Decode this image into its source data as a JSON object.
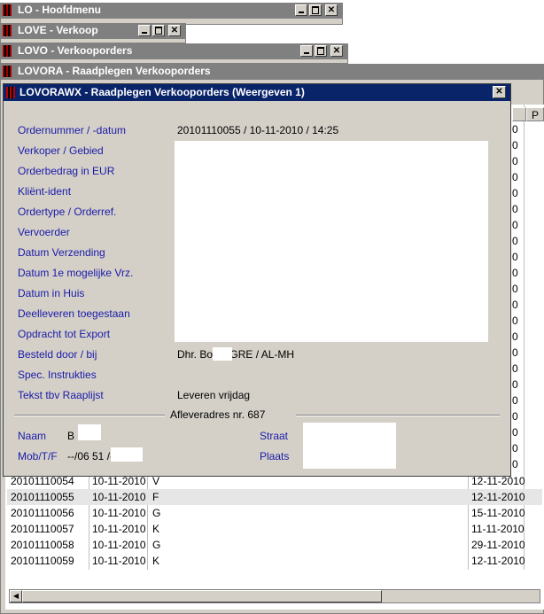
{
  "windows": [
    {
      "title": "LO - Hoofdmenu"
    },
    {
      "title": "LOVE - Verkoop"
    },
    {
      "title": "LOVO - Verkooporders"
    },
    {
      "title": "LOVORA - Raadplegen Verkooporders"
    }
  ],
  "grid": {
    "header_p": "P",
    "right_dates": [
      "0",
      "0",
      "0",
      "0",
      "0",
      "0",
      "0",
      "0",
      "0",
      "0",
      "0",
      "0",
      "0",
      "0",
      "0",
      "0",
      "0",
      "0",
      "0",
      "0",
      "0",
      "0"
    ],
    "rows": [
      {
        "order": "20101110054",
        "date": "10-11-2010",
        "code": "V",
        "due": "12-11-2010"
      },
      {
        "order": "20101110055",
        "date": "10-11-2010",
        "code": "F",
        "due": "12-11-2010"
      },
      {
        "order": "20101110056",
        "date": "10-11-2010",
        "code": "G",
        "due": "15-11-2010"
      },
      {
        "order": "20101110057",
        "date": "10-11-2010",
        "code": "K",
        "due": "11-11-2010"
      },
      {
        "order": "20101110058",
        "date": "10-11-2010",
        "code": "G",
        "due": "29-11-2010"
      },
      {
        "order": "20101110059",
        "date": "10-11-2010",
        "code": "K",
        "due": "12-11-2010"
      }
    ]
  },
  "dialog": {
    "title": "LOVORAWX - Raadplegen Verkooporders (Weergeven 1)",
    "labels": {
      "ordernummer": "Ordernummer / -datum",
      "verkoper": "Verkoper / Gebied",
      "orderbedrag": "Orderbedrag in EUR",
      "klient": "Kliënt-ident",
      "ordertype": "Ordertype / Orderref.",
      "vervoerder": "Vervoerder",
      "datum_verzending": "Datum Verzending",
      "datum_1e": "Datum 1e mogelijke Vrz.",
      "datum_huis": "Datum in Huis",
      "deelleveren": "Deelleveren toegestaan",
      "opdracht_export": "Opdracht tot Export",
      "besteld_door": "Besteld door / bij",
      "spec_instructies": "Spec. Instrukties",
      "tekst_raaplijst": "Tekst tbv Raaplijst"
    },
    "values": {
      "ordernummer": "20101110055 / 10-11-2010 / 14:25",
      "besteld_door": "Dhr. Bo     k / GRE / AL-MH",
      "tekst_raaplijst": "Leveren vrijdag"
    },
    "afleveradres": {
      "title": "Afleveradres nr. 687",
      "naam_label": "Naam",
      "naam_value": "B    k",
      "mob_label": "Mob/T/F",
      "mob_value": "--/06 51         /--",
      "straat_label": "Straat",
      "plaats_label": "Plaats"
    }
  }
}
